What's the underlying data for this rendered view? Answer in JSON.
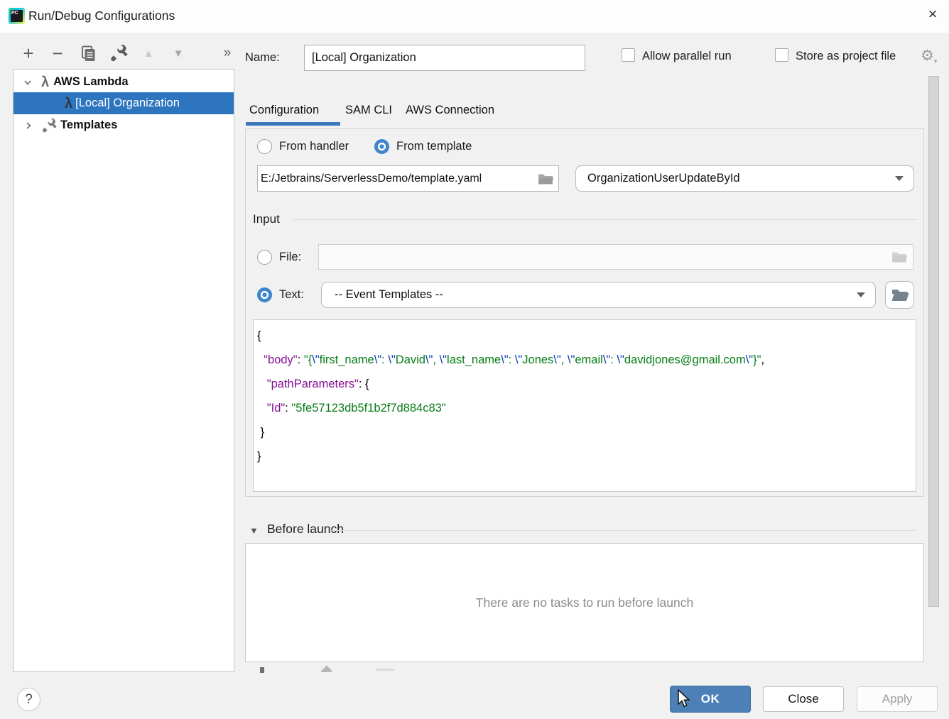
{
  "window": {
    "title": "Run/Debug Configurations",
    "close_glyph": "×"
  },
  "toolbar": {
    "add_glyph": "+",
    "remove_glyph": "−",
    "move_up_glyph": "▲",
    "move_down_glyph": "▼",
    "more_glyph": "»"
  },
  "tree": {
    "items": [
      {
        "label": "AWS Lambda",
        "expanded": true,
        "selected": false
      },
      {
        "label": "[Local] Organization",
        "selected": true
      },
      {
        "label": "Templates",
        "expanded": false,
        "selected": false
      }
    ]
  },
  "form": {
    "name_label": "Name:",
    "name_value": "[Local] Organization",
    "allow_parallel_label": "Allow parallel run",
    "store_project_label": "Store as project file"
  },
  "tabs": [
    {
      "label": "Configuration",
      "selected": true
    },
    {
      "label": "SAM CLI",
      "selected": false
    },
    {
      "label": "AWS Connection",
      "selected": false
    }
  ],
  "config": {
    "from_handler_label": "From handler",
    "from_template_label": "From template",
    "selected_source": "From template",
    "template_path": "E:/Jetbrains/ServerlessDemo/template.yaml",
    "function_value": "OrganizationUserUpdateById",
    "input_section_label": "Input",
    "file_label": "File:",
    "file_value": "",
    "text_label": "Text:",
    "event_templates_value": "-- Event Templates --"
  },
  "editor": {
    "lines": [
      [
        [
          "punct",
          "{"
        ]
      ],
      [
        [
          "punct",
          "  "
        ],
        [
          "key",
          "\"body\""
        ],
        [
          "punct",
          ": "
        ],
        [
          "str",
          "\"{"
        ],
        [
          "esc",
          "\\\""
        ],
        [
          "str",
          "first_name"
        ],
        [
          "esc",
          "\\\""
        ],
        [
          "str",
          ": "
        ],
        [
          "esc",
          "\\\""
        ],
        [
          "str",
          "David"
        ],
        [
          "esc",
          "\\\""
        ],
        [
          "str",
          ", "
        ],
        [
          "esc",
          "\\\""
        ],
        [
          "str",
          "last_name"
        ],
        [
          "esc",
          "\\\""
        ],
        [
          "str",
          ": "
        ],
        [
          "esc",
          "\\\""
        ],
        [
          "str",
          "Jones"
        ],
        [
          "esc",
          "\\\""
        ],
        [
          "str",
          ", "
        ],
        [
          "esc",
          "\\\""
        ],
        [
          "str",
          "email"
        ],
        [
          "esc",
          "\\\""
        ],
        [
          "str",
          ": "
        ],
        [
          "esc",
          "\\\""
        ],
        [
          "str",
          "davidjones@gmail.com"
        ],
        [
          "esc",
          "\\\""
        ],
        [
          "str",
          "}\""
        ],
        [
          "punct",
          ","
        ]
      ],
      [
        [
          "punct",
          "   "
        ],
        [
          "key",
          "\"pathParameters\""
        ],
        [
          "punct",
          ": {"
        ]
      ],
      [
        [
          "punct",
          "   "
        ],
        [
          "key",
          "\"Id\""
        ],
        [
          "punct",
          ": "
        ],
        [
          "str",
          "\"5fe57123db5f1b2f7d884c83\""
        ]
      ],
      [
        [
          "punct",
          " }"
        ]
      ],
      [
        [
          "punct",
          "}"
        ]
      ]
    ]
  },
  "before_launch": {
    "label": "Before launch",
    "empty_text": "There are no tasks to run before launch"
  },
  "footer": {
    "help_glyph": "?",
    "ok_label": "OK",
    "close_label": "Close",
    "apply_label": "Apply"
  },
  "colors": {
    "tree_selection": "#2e75c0",
    "tab_underline": "#3d78ba",
    "radio_accent": "#3f86cc",
    "ok_button": "#4d80b7",
    "json_key": "#871094",
    "json_string": "#067d17",
    "json_escape": "#0033b3",
    "background": "#f1f1f1"
  }
}
